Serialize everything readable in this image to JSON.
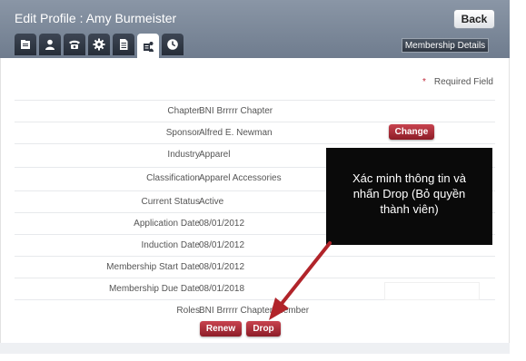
{
  "header": {
    "title": "Edit Profile : Amy Burmeister",
    "back_label": "Back",
    "membership_details_label": "Membership Details",
    "tabs": [
      {
        "icon": "document-icon"
      },
      {
        "icon": "person-icon"
      },
      {
        "icon": "phone-icon"
      },
      {
        "icon": "gear-icon"
      },
      {
        "icon": "notes-icon"
      },
      {
        "icon": "membership-icon",
        "active": true
      },
      {
        "icon": "clock-icon"
      }
    ]
  },
  "form": {
    "required_marker": "*",
    "required_text": "Required Field",
    "rows": [
      {
        "label": "Chapter",
        "value": "BNI Brrrrr Chapter"
      },
      {
        "label": "Sponsor",
        "value": "Alfred E. Newman"
      },
      {
        "label": "Industry",
        "value": "Apparel"
      },
      {
        "label": "Classification",
        "value": "Apparel Accessories"
      },
      {
        "label": "Current Status",
        "value": "Active"
      },
      {
        "label": "Application Date",
        "value": "08/01/2012"
      },
      {
        "label": "Induction Date",
        "value": "08/01/2012"
      },
      {
        "label": "Membership Start Date",
        "value": "08/01/2012"
      },
      {
        "label": "Membership Due Date",
        "value": "08/01/2018"
      },
      {
        "label": "Roles",
        "value": "BNI Brrrrr Chapter-Member"
      }
    ],
    "change_label": "Change",
    "renew_label": "Renew",
    "drop_label": "Drop"
  },
  "callout": {
    "line1": "Xác minh thông tin và",
    "line2": "nhấn Drop (Bỏ quyền",
    "line3": "thành viên)"
  },
  "colors": {
    "header_bg": "#7b8798",
    "accent_red": "#a72a35",
    "arrow": "#b1242a"
  }
}
